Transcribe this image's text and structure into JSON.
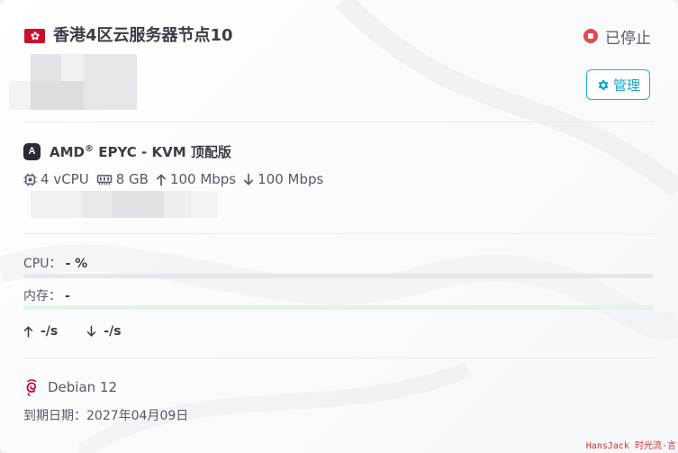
{
  "server": {
    "region_flag": "hk-flag-icon",
    "name": "香港4区云服务器节点10",
    "status": "已停止",
    "manage_label": "管理"
  },
  "specs": {
    "cpu_brand_badge": "A",
    "cpu_model": "AMD",
    "cpu_model_suffix": "EPYC - KVM 顶配版",
    "registered_mark": "®",
    "vcpu": "4 vCPU",
    "ram": "8 GB",
    "upload": "100 Mbps",
    "download": "100 Mbps"
  },
  "usage": {
    "cpu_label": "CPU：",
    "cpu_value": "- %",
    "mem_label": "内存：",
    "mem_value": "-",
    "up_speed": "-/s",
    "down_speed": "-/s"
  },
  "os": {
    "icon": "debian-icon",
    "name": "Debian 12"
  },
  "expiry": "到期日期：2027年04月09日",
  "watermark": "HansJack 时光流·言",
  "colors": {
    "status_stopped": "#e5484d",
    "accent": "#13a3c6",
    "cpu_bar": "#e6e7ea",
    "mem_bar": "#dff5ea",
    "flag_red": "#c8102e"
  }
}
